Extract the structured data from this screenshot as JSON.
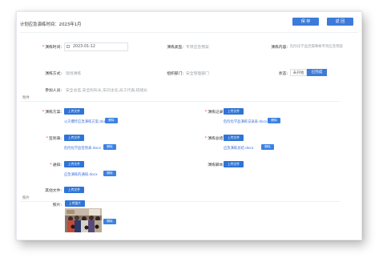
{
  "header": {
    "title": "计划应急演练时间：2023年1月",
    "save_label": "保 存",
    "back_label": "返 回"
  },
  "form": {
    "drill_time": {
      "label": "演练时间:",
      "value": "2023-01-12"
    },
    "drill_type": {
      "label": "演练类型:",
      "value": "专项应急预案"
    },
    "drill_content": {
      "label": "演练内容:",
      "value": "危险化学品泄漏事故专项应急预案"
    },
    "drill_form": {
      "label": "演练方式:",
      "value": "现场演练"
    },
    "org_dept": {
      "label": "组织部门:",
      "value": "安全管理部门"
    },
    "status": {
      "label": "状态:",
      "options": [
        "未开始",
        "已完成"
      ],
      "selected": "已完成"
    },
    "participants": {
      "label": "参加人员:",
      "value": "安全总监,安全科科长,车间主任,员工代表,班组长"
    }
  },
  "attachments": {
    "section_label": "附件",
    "upload_label": "上传文件",
    "delete_label": "删除",
    "plan": {
      "label": "演练方案:",
      "file": "火灾爆炸应急演练方案.docx"
    },
    "record": {
      "label": "演练记录:",
      "file": "危险化学品演练记录表.docx"
    },
    "signin": {
      "label": "签到表:",
      "file": "危险化学品签到表.docx"
    },
    "summary": {
      "label": "演练总结:",
      "file": "应急演练总结.docx"
    },
    "notice": {
      "label": "通知:",
      "file": "应急演练的通知.docx"
    },
    "script": {
      "label": "演练脚本:"
    },
    "other": {
      "label": "其他文件:"
    }
  },
  "photos": {
    "section_label": "照片",
    "label": "照片:",
    "upload_label": "上传图片",
    "delete_label": "删除"
  },
  "colors": {
    "primary": "#3d7bd9",
    "required": "#e44444",
    "link": "#3a6fd8"
  }
}
